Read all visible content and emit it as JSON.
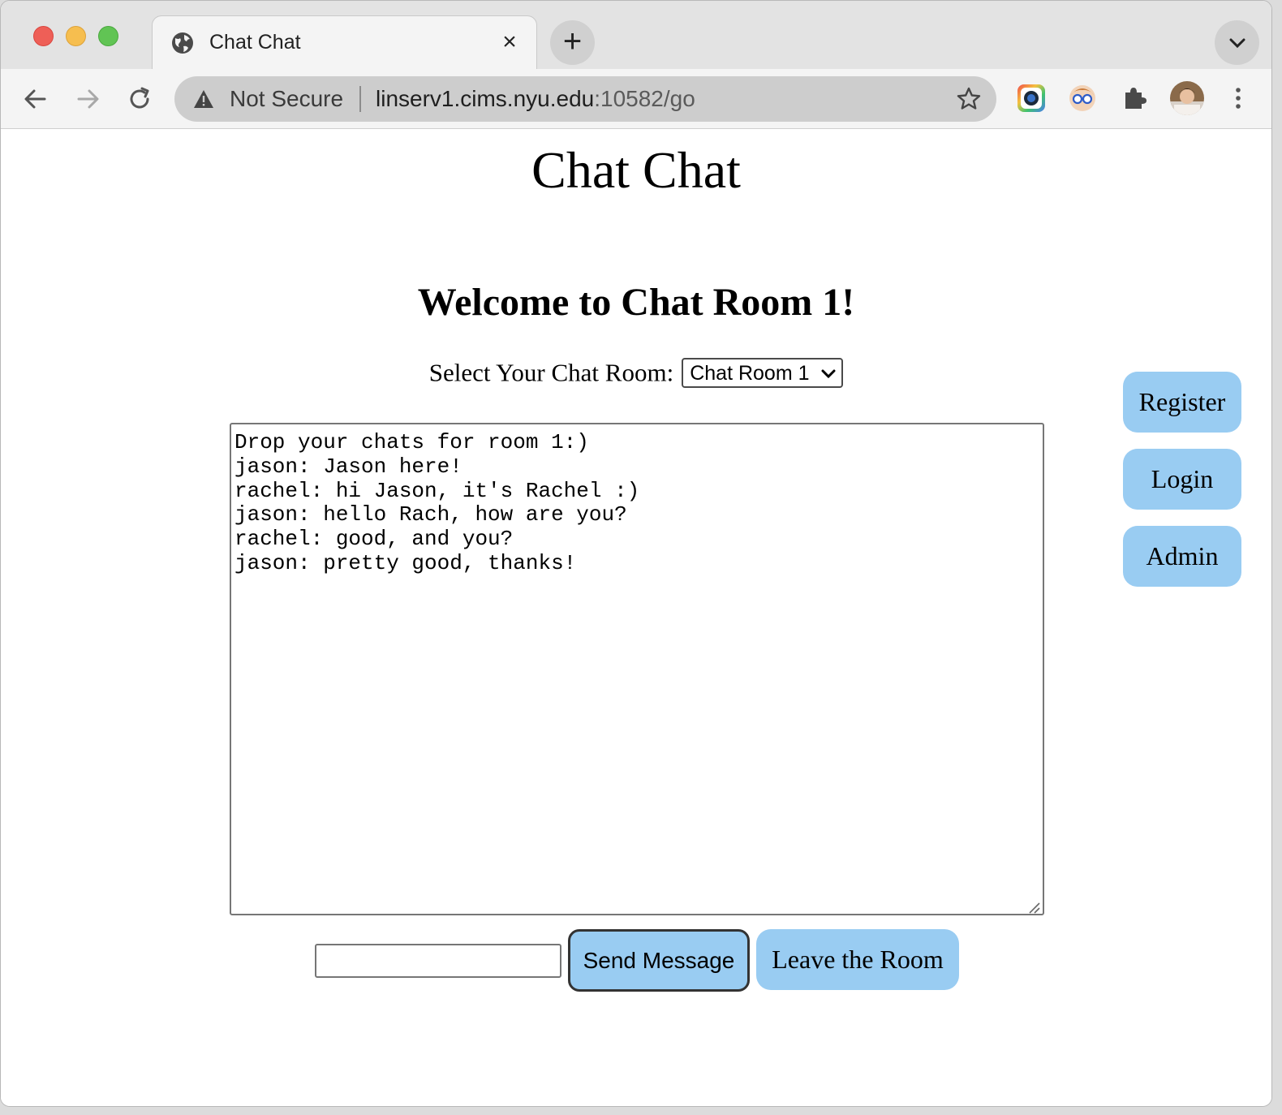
{
  "browser": {
    "tab_title": "Chat Chat",
    "tab_close": "×",
    "new_tab": "+",
    "security_label": "Not Secure",
    "url_host": "linserv1.cims.nyu.edu",
    "url_path": ":10582/go"
  },
  "page": {
    "title": "Chat Chat",
    "welcome": "Welcome to Chat Room 1!",
    "room_label": "Select Your Chat Room:",
    "room_selected": "Chat Room 1",
    "chat_log": "Drop your chats for room 1:)\njason: Jason here!\nrachel: hi Jason, it's Rachel :)\njason: hello Rach, how are you?\nrachel: good, and you?\njason: pretty good, thanks!",
    "message_value": "",
    "send_label": "Send Message",
    "leave_label": "Leave the Room",
    "register_label": "Register",
    "login_label": "Login",
    "admin_label": "Admin"
  },
  "colors": {
    "button_fill": "#99ccf2"
  },
  "icons": [
    "globe-icon",
    "close-icon",
    "plus-icon",
    "chevron-down-icon",
    "back-arrow-icon",
    "forward-arrow-icon",
    "reload-icon",
    "warning-icon",
    "star-icon",
    "extension-camera-icon",
    "extension-glasses-icon",
    "puzzle-icon",
    "profile-avatar",
    "more-vert-icon"
  ]
}
